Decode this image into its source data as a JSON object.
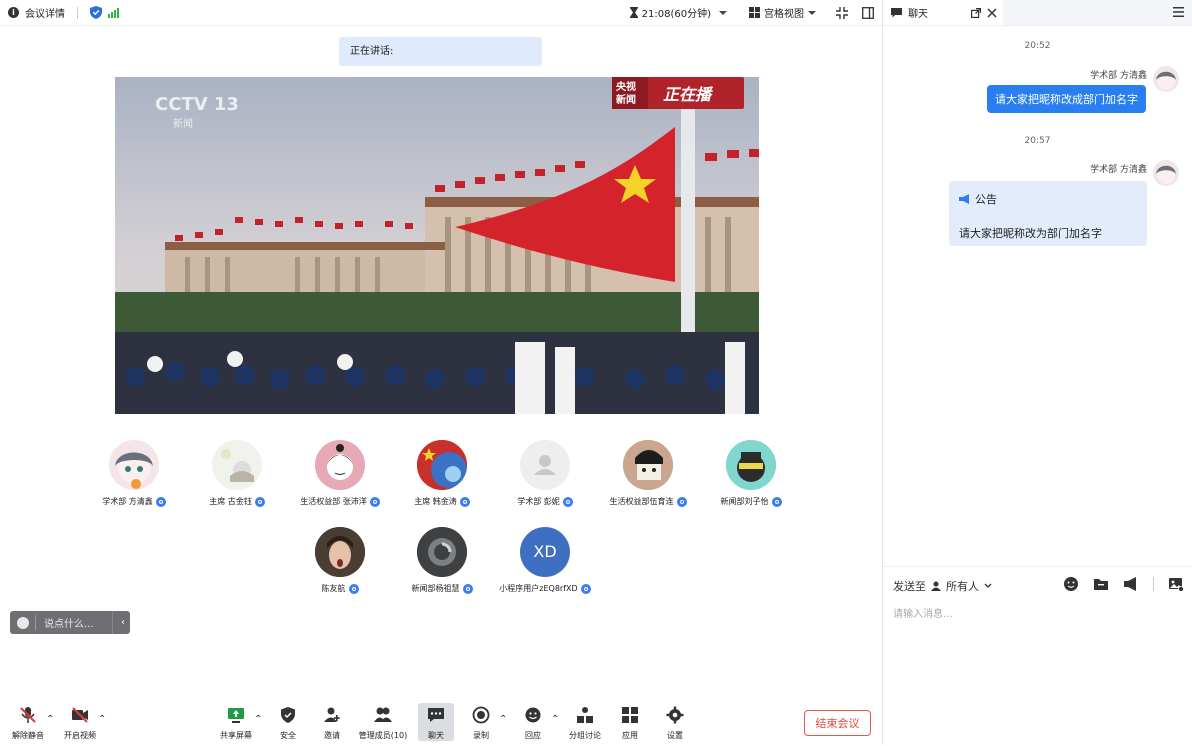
{
  "topbar": {
    "meeting_details": "会议详情",
    "timer": "21:08(60分钟)",
    "view_mode": "宫格视图"
  },
  "speaking": "正在讲话:",
  "video": {
    "channel_logo": "CCTV 13",
    "channel_sub": "新闻",
    "overlay_tag_1": "央视",
    "overlay_tag_2": "新闻",
    "overlay_live": "正在播"
  },
  "participants": [
    {
      "name": "学术部 方清鑫",
      "avatar_color": "#f3e5e8"
    },
    {
      "name": "主席 古金钰",
      "avatar_color": "#f1f2ee"
    },
    {
      "name": "生活权益部 张沛洋",
      "avatar_color": "#e8a9b6"
    },
    {
      "name": "主席 韩金涛",
      "avatar_color": "#c03a2b"
    },
    {
      "name": "学术部 彭妮",
      "avatar_color": "#eeeeee"
    },
    {
      "name": "生活权益部伍育连",
      "avatar_color": "#c9a68d"
    },
    {
      "name": "新闻部刘子怡",
      "avatar_color": "#7fd7cf"
    },
    {
      "name": "陈友航",
      "avatar_color": "#4a3d34"
    },
    {
      "name": "新闻部杨祖慧",
      "avatar_color": "#5a5c5e"
    },
    {
      "name": "小程序用户zEQ8rfXD",
      "avatar_color": "#3f6fc0",
      "initials": "XD"
    }
  ],
  "saybox": {
    "placeholder": "说点什么..."
  },
  "toolbar": {
    "mute": "解除静音",
    "video": "开启视频",
    "share": "共享屏幕",
    "security": "安全",
    "invite": "邀请",
    "members": "管理成员(10)",
    "chat": "聊天",
    "record": "录制",
    "react": "回应",
    "breakout": "分组讨论",
    "apps": "应用",
    "settings": "设置",
    "end": "结束会议"
  },
  "chat": {
    "title": "聊天",
    "messages": [
      {
        "time": "20:52",
        "sender": "学术部 方清鑫",
        "text": "请大家把昵称改成部门加名字"
      },
      {
        "time": "20:57",
        "sender": "学术部 方清鑫",
        "notice_title": "公告",
        "text": "请大家把昵称改为部门加名字"
      }
    ],
    "send_to_label": "发送至",
    "send_to_value": "所有人",
    "input_placeholder": "请输入消息..."
  },
  "colors": {
    "accent": "#2a7ff0",
    "end_button": "#e04a3a",
    "notice_bg": "#e2ecfb"
  }
}
